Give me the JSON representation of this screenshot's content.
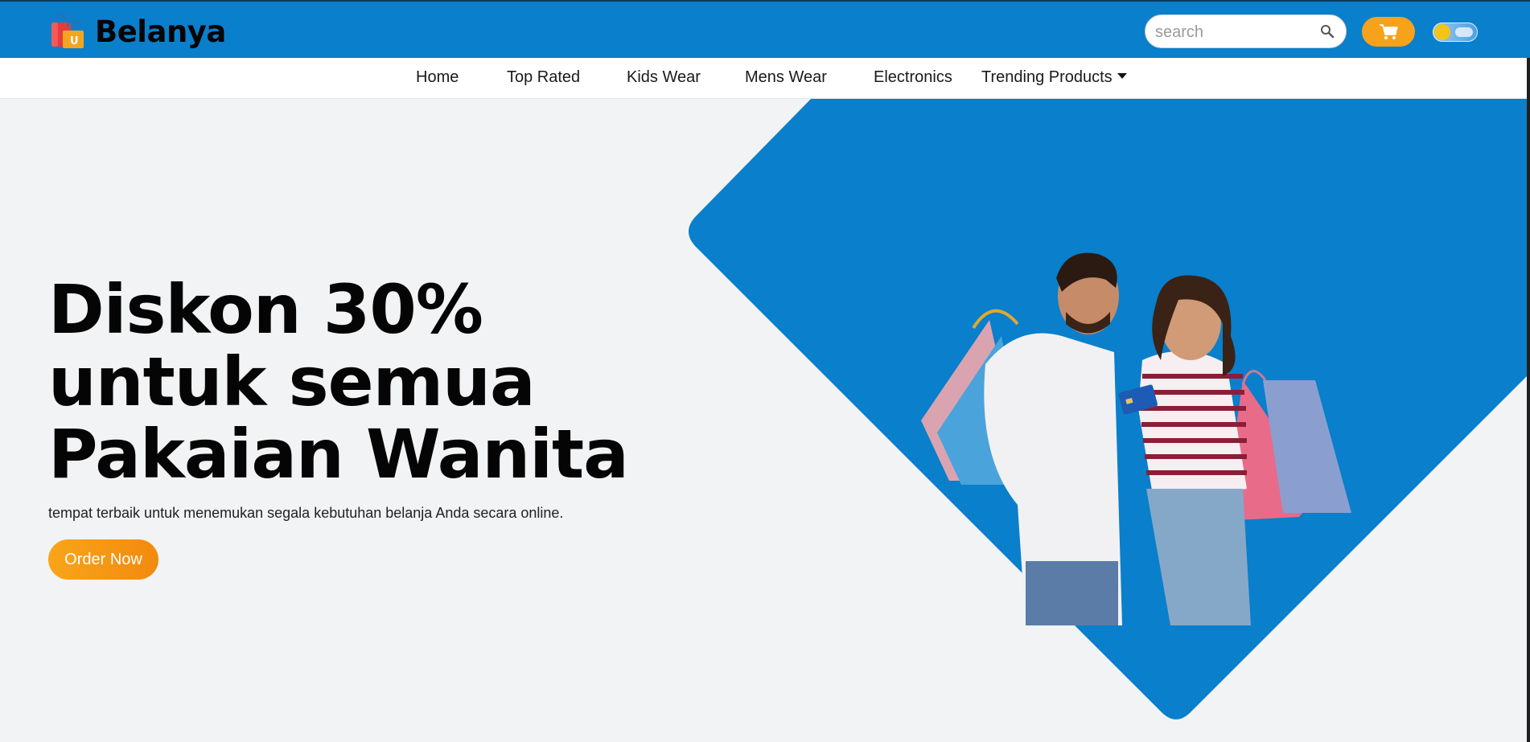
{
  "brand": {
    "name": "Belanya",
    "logo_icon": "shopping-bags-icon"
  },
  "search": {
    "placeholder": "search",
    "value": "",
    "icon": "search-icon"
  },
  "cart": {
    "icon": "cart-icon"
  },
  "theme_toggle": {
    "icon": "sun-cloud-toggle",
    "state": "light"
  },
  "nav": {
    "items": [
      {
        "label": "Home"
      },
      {
        "label": "Top Rated"
      },
      {
        "label": "Kids Wear"
      },
      {
        "label": "Mens Wear"
      },
      {
        "label": "Electronics"
      },
      {
        "label": "Trending Products",
        "icon": "caret-down-icon"
      }
    ]
  },
  "hero": {
    "title": "Diskon 30% untuk semua Pakaian Wanita",
    "subtitle": "tempat terbaik untuk menemukan segala kebutuhan belanja Anda secara online.",
    "cta_label": "Order Now",
    "image_icon": "couple-with-shopping-bags-photo"
  },
  "colors": {
    "primary": "#0a7fcb",
    "accent": "#f7a21b",
    "background": "#f2f3f5",
    "nav_background": "#ffffff"
  }
}
